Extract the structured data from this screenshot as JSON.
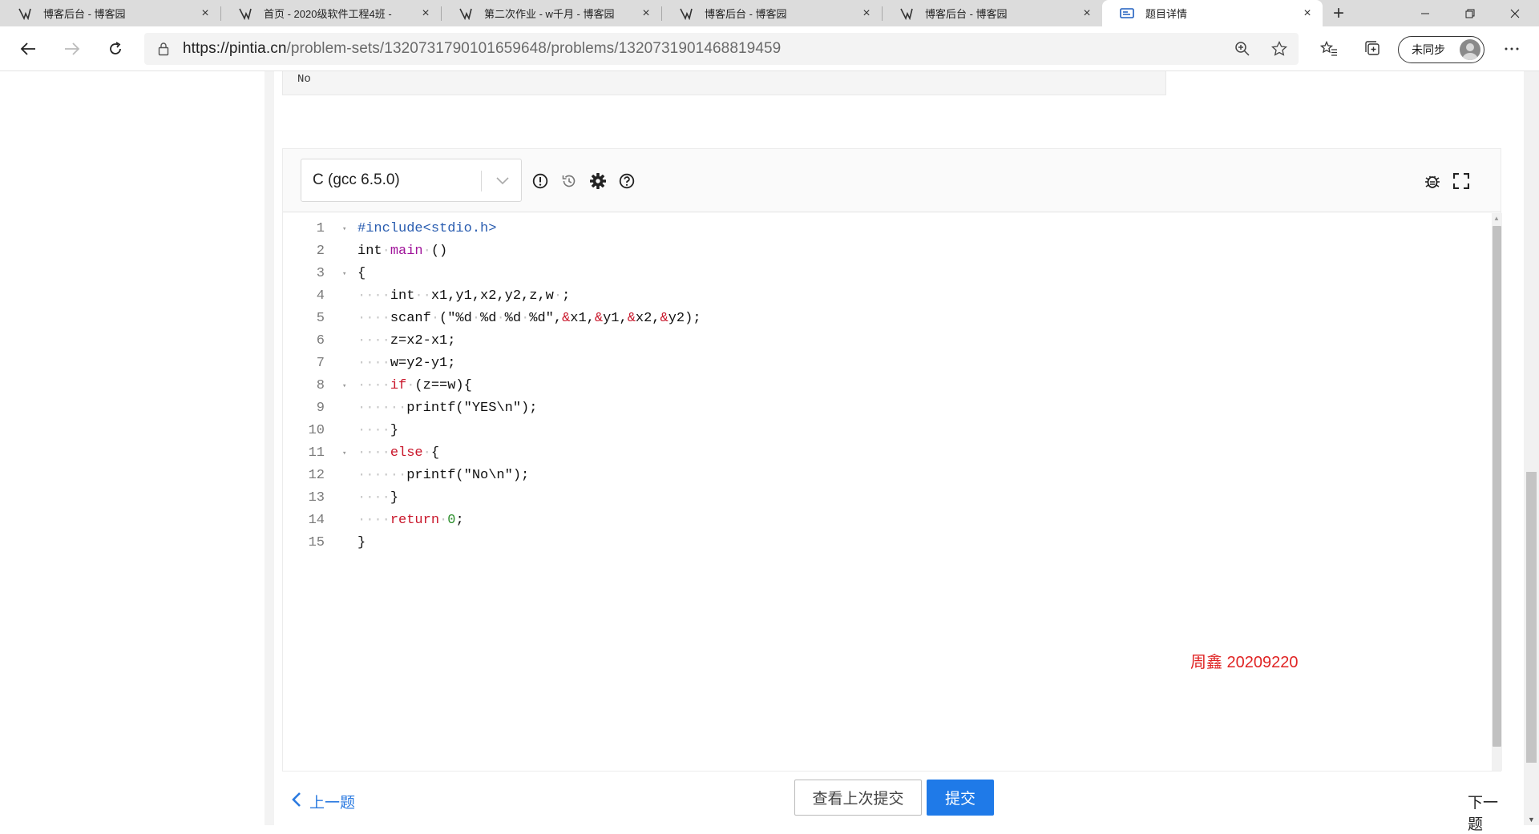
{
  "browser": {
    "tabs": [
      {
        "title": "博客后台 - 博客园",
        "close": "×"
      },
      {
        "title": "首页 - 2020级软件工程4班 - ",
        "close": "×"
      },
      {
        "title": "第二次作业 - w千月 - 博客园",
        "close": "×"
      },
      {
        "title": "博客后台 - 博客园",
        "close": "×"
      },
      {
        "title": "博客后台 - 博客园",
        "close": "×"
      },
      {
        "title": "题目详情",
        "close": "×"
      }
    ],
    "new_tab": "+",
    "url_host": "https://pintia.cn",
    "url_path": "/problem-sets/1320731790101659648/problems/1320731901468819459",
    "sync_label": "未同步"
  },
  "sample_output": "No",
  "editor": {
    "language": "C (gcc 6.5.0)",
    "lines": [
      {
        "n": "1",
        "fold": "▾"
      },
      {
        "n": "2",
        "fold": ""
      },
      {
        "n": "3",
        "fold": "▾"
      },
      {
        "n": "4",
        "fold": ""
      },
      {
        "n": "5",
        "fold": ""
      },
      {
        "n": "6",
        "fold": ""
      },
      {
        "n": "7",
        "fold": ""
      },
      {
        "n": "8",
        "fold": "▾"
      },
      {
        "n": "9",
        "fold": ""
      },
      {
        "n": "10",
        "fold": ""
      },
      {
        "n": "11",
        "fold": "▾"
      },
      {
        "n": "12",
        "fold": ""
      },
      {
        "n": "13",
        "fold": ""
      },
      {
        "n": "14",
        "fold": ""
      },
      {
        "n": "15",
        "fold": ""
      }
    ],
    "code": {
      "l1": "#include<stdio.h>",
      "l2a": "int",
      "l2b": "main",
      "l2c": "()",
      "l3": "{",
      "l4a": "int",
      "l4b": "x1,y1,x2,y2,z,w",
      "l4c": ";",
      "l5a": "scanf",
      "l5b": "(\"%d",
      "l5c": "%d",
      "l5d": "%d",
      "l5e": "%d\",",
      "l5f": "&",
      "l5g": "x1,",
      "l5h": "&",
      "l5i": "y1,",
      "l5j": "&",
      "l5k": "x2,",
      "l5l": "&",
      "l5m": "y2);",
      "l6": "z=x2-x1;",
      "l7": "w=y2-y1;",
      "l8a": "if",
      "l8b": "(z==w){",
      "l9": "printf(\"YES\\n\");",
      "l10": "}",
      "l11a": "else",
      "l11b": "{",
      "l12": "printf(\"No\\n\");",
      "l13": "}",
      "l14a": "return",
      "l14b": "0",
      "l14c": ";",
      "l15": "}"
    }
  },
  "watermark": "周鑫 20209220",
  "nav": {
    "prev": "上一题",
    "view_last": "查看上次提交",
    "submit": "提交",
    "next": "下一题"
  }
}
